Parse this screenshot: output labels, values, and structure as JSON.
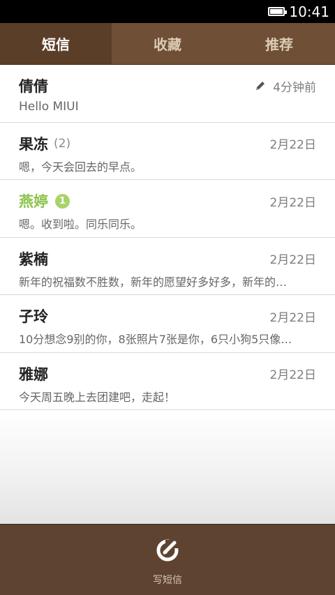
{
  "status_bar": {
    "time": "10:41"
  },
  "tabs": [
    {
      "label": "短信",
      "active": true
    },
    {
      "label": "收藏",
      "active": false
    },
    {
      "label": "推荐",
      "active": false
    }
  ],
  "conversations": [
    {
      "name": "倩倩",
      "count": "",
      "unread": "",
      "time": "4分钟前",
      "preview": "Hello MIUI"
    },
    {
      "name": "果冻",
      "count": "(2)",
      "unread": "",
      "time": "2月22日",
      "preview": "嗯，今天会回去的早点。"
    },
    {
      "name": "燕婷",
      "count": "",
      "unread": "1",
      "time": "2月22日",
      "preview": "嗯。收到啦。同乐同乐。"
    },
    {
      "name": "紫楠",
      "count": "",
      "unread": "",
      "time": "2月22日",
      "preview": "新年的祝福数不胜数，新年的愿望好多好多，新年的…"
    },
    {
      "name": "子玲",
      "count": "",
      "unread": "",
      "time": "2月22日",
      "preview": "10分想念9别的你，8张照片7张是你，6只小狗5只像…"
    },
    {
      "name": "雅娜",
      "count": "",
      "unread": "",
      "time": "2月22日",
      "preview": "今天周五晚上去团建吧，走起！"
    }
  ],
  "bottom_bar": {
    "compose_label": "写短信"
  },
  "colors": {
    "tab_bar": "#6f4f36",
    "tab_active": "#5b3e28",
    "bottom_bar": "#5d4330",
    "unread_accent": "#8bc34a"
  }
}
